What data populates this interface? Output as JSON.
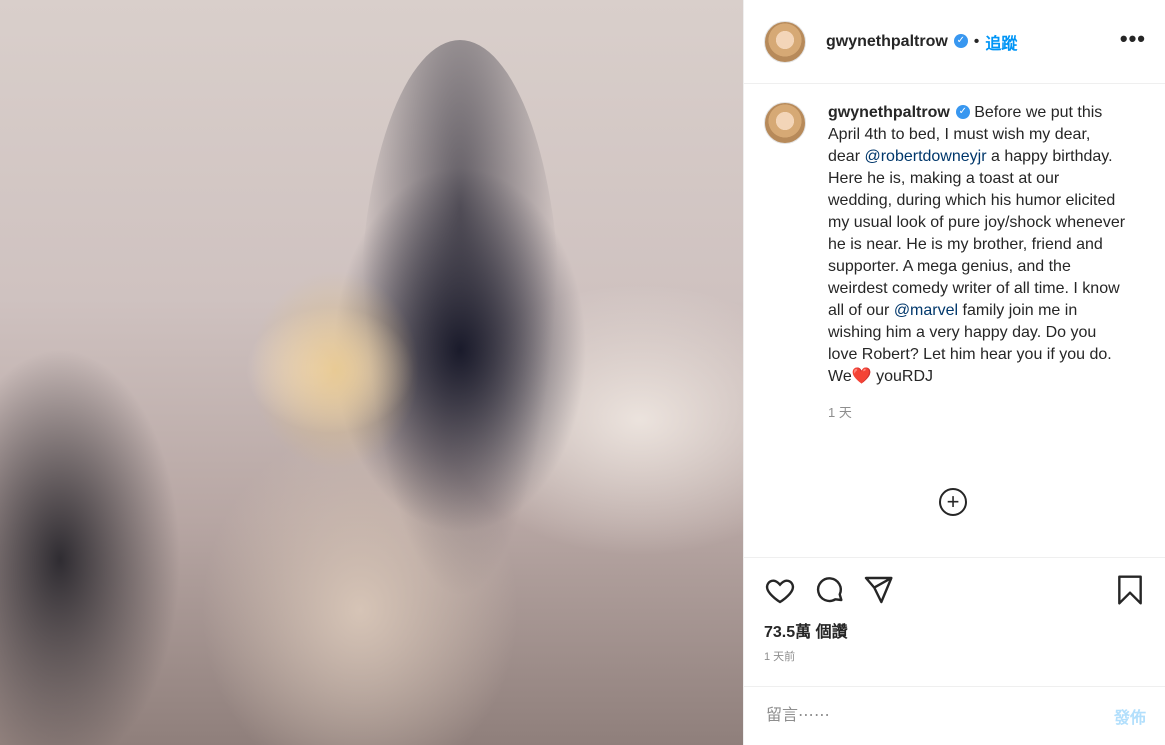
{
  "post": {
    "username": "gwynethpaltrow",
    "follow_label": "追蹤",
    "more_label": "•••",
    "verified_glyph": "✓"
  },
  "caption": {
    "username": "gwynethpaltrow",
    "text_before_mention": " Before we put this April 4th to bed, I must wish my dear, dear ",
    "mention1": "@robertdowneyjr",
    "text_middle": " a happy birthday. Here he is, making a toast at our wedding, during which his humor elicited my usual look of pure joy/shock whenever he is near. He is my brother, friend and supporter. A mega genius, and the weirdest comedy writer of all time. I know all of our ",
    "mention2": "@marvel",
    "text_after": " family join me in wishing him a very happy day. Do you love Robert? Let him hear you if you do. We",
    "heart": "❤️",
    "text_end": " youRDJ",
    "time_ago": "1 天"
  },
  "load_more": "+",
  "stats": {
    "likes": "73.5萬 個讚",
    "posted": "1 天前"
  },
  "comment": {
    "placeholder": "留言⋯⋯",
    "post_label": "發佈"
  },
  "icons": [
    "like-heart-icon",
    "comment-icon",
    "share-icon",
    "save-bookmark-icon",
    "add-circle-icon",
    "more-icon",
    "verified-icon"
  ]
}
